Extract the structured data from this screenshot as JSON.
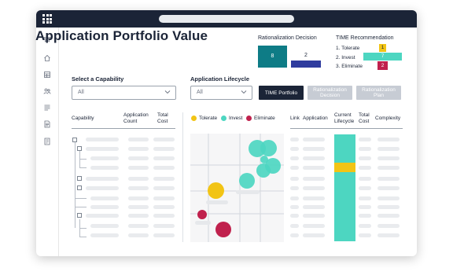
{
  "app": {
    "title": "Application Portfolio Value"
  },
  "rationalization": {
    "title": "Rationalization Decision",
    "values": [
      {
        "value": "8",
        "color": "#0e7c86"
      },
      {
        "value": "2",
        "color": "#2f3c9e"
      }
    ]
  },
  "time_recommendation": {
    "title": "TIME Recommendation",
    "items": [
      {
        "label": "1. Tolerate",
        "value": "1",
        "color": "#f2c415"
      },
      {
        "label": "2. Invest",
        "value": "7",
        "color": "#4dd6c1"
      },
      {
        "label": "3. Eliminate",
        "value": "2",
        "color": "#c0214d"
      }
    ]
  },
  "capability": {
    "label": "Select a Capability",
    "value": "All",
    "columns": [
      "Capability",
      "Application Count",
      "Total Cost"
    ]
  },
  "lifecycle": {
    "label": "Application Lifecycle",
    "value": "All"
  },
  "tabs": [
    {
      "label": "TIME Portfolio",
      "active": true
    },
    {
      "label": "Rationalization Decision",
      "active": false
    },
    {
      "label": "Rationalization Plan",
      "active": false
    }
  ],
  "legend": [
    {
      "label": "Tolerate",
      "color": "#f2c415"
    },
    {
      "label": "Invest",
      "color": "#4dd6c1"
    },
    {
      "label": "Eliminate",
      "color": "#c0214d"
    }
  ],
  "details_table": {
    "columns": [
      "Link",
      "Application",
      "Current Lifecycle",
      "Total Cost",
      "Complexity"
    ]
  },
  "icons": [
    "apps-grid-icon",
    "star-icon",
    "home-icon",
    "dashboard-icon",
    "people-icon",
    "list-icon",
    "document-icon",
    "report-icon",
    "chevron-down-icon"
  ]
}
